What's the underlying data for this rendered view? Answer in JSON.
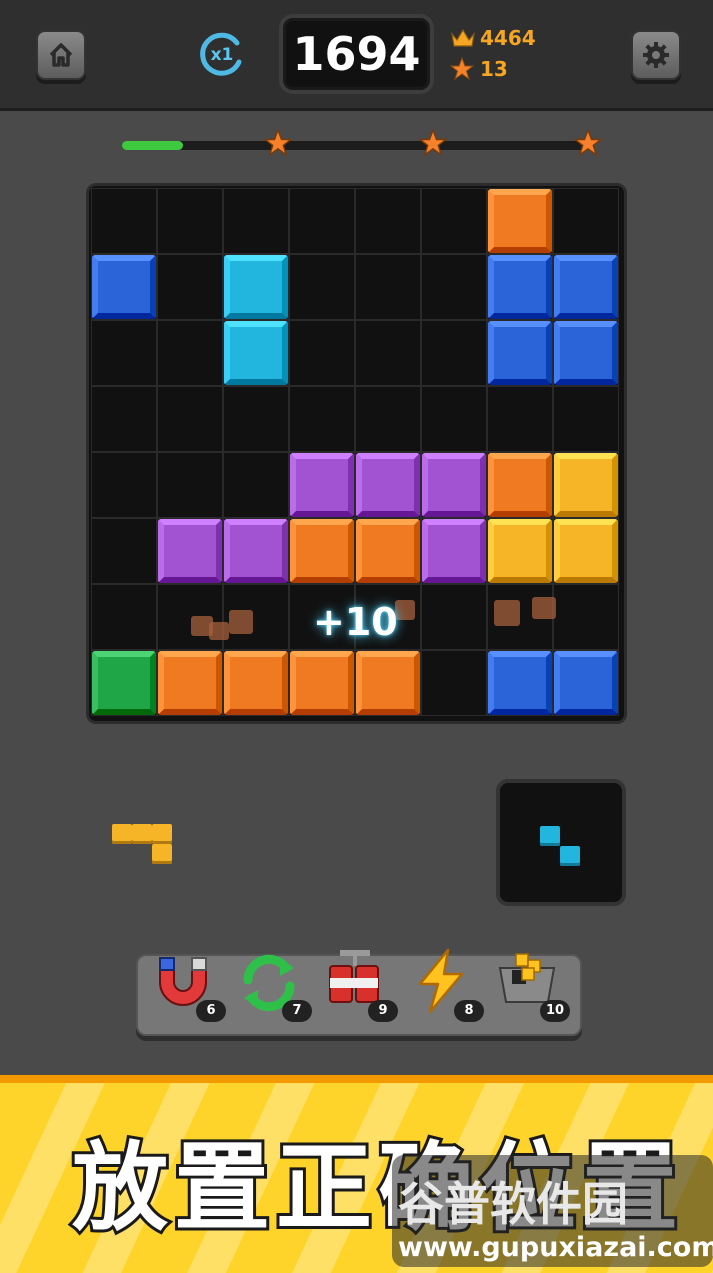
{
  "header": {
    "combo_label": "x1",
    "score": "1694",
    "best_score": "4464",
    "stars": "13"
  },
  "progress": {
    "fraction": 0.13,
    "stars_count": 3
  },
  "colors": {
    "orange": "#f07a22",
    "blue": "#2b63d9",
    "cyan": "#22b5dd",
    "purple": "#a153d1",
    "yellow": "#f6b526",
    "green": "#1fa646"
  },
  "board": {
    "rows": [
      [
        null,
        null,
        null,
        null,
        null,
        null,
        "orange",
        null
      ],
      [
        "blue",
        null,
        "cyan",
        null,
        null,
        null,
        "blue",
        "blue"
      ],
      [
        null,
        null,
        "cyan",
        null,
        null,
        null,
        "blue",
        "blue"
      ],
      [
        null,
        null,
        null,
        null,
        null,
        null,
        null,
        null
      ],
      [
        null,
        null,
        null,
        "purple",
        "purple",
        "purple",
        "orange",
        "yellow"
      ],
      [
        null,
        "purple",
        "purple",
        "orange",
        "orange",
        "purple",
        "yellow",
        "yellow"
      ],
      [
        null,
        null,
        null,
        null,
        null,
        null,
        null,
        null
      ],
      [
        "green",
        "orange",
        "orange",
        "orange",
        "orange",
        null,
        "blue",
        "blue"
      ]
    ]
  },
  "score_popup": "+10",
  "powerups": [
    {
      "name": "magnet-icon",
      "count": "6"
    },
    {
      "name": "refresh-icon",
      "count": "7"
    },
    {
      "name": "tnt-icon",
      "count": "9"
    },
    {
      "name": "lightning-icon",
      "count": "8"
    },
    {
      "name": "block-crate-icon",
      "count": "10"
    }
  ],
  "banner": {
    "text": "放置正确位置"
  },
  "watermark": {
    "logo": "谷普软件园",
    "url": "www.gupuxiazai.com"
  }
}
